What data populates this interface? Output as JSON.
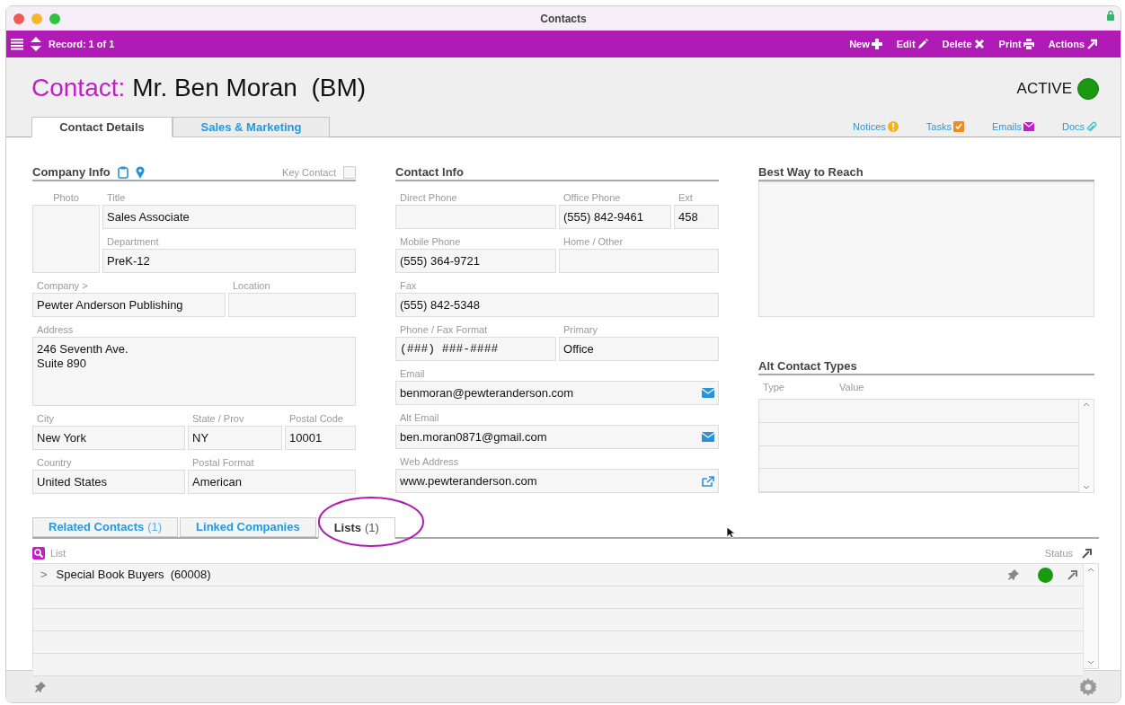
{
  "window": {
    "title": "Contacts"
  },
  "toolbar": {
    "record": "Record: 1 of 1",
    "actions": [
      {
        "label": "New"
      },
      {
        "label": "Edit"
      },
      {
        "label": "Delete"
      },
      {
        "label": "Print"
      },
      {
        "label": "Actions"
      }
    ]
  },
  "header": {
    "prefix": "Contact:",
    "name": "Mr. Ben Moran  (BM)",
    "status": "ACTIVE"
  },
  "tabs": [
    {
      "label": "Contact Details",
      "selected": true
    },
    {
      "label": "Sales & Marketing",
      "selected": false
    }
  ],
  "quick_links": [
    {
      "label": "Notices"
    },
    {
      "label": "Tasks"
    },
    {
      "label": "Emails"
    },
    {
      "label": "Docs"
    }
  ],
  "company_info": {
    "title": "Company Info",
    "key_contact": {
      "label": "Key Contact",
      "checked": false
    },
    "photo_label": "Photo",
    "side_rows": [
      [
        {
          "label": "Title",
          "value": "Sales Associate",
          "kind": "text"
        }
      ],
      [
        {
          "label": "Department",
          "value": "PreK-12",
          "kind": "text"
        }
      ]
    ],
    "rows": [
      [
        {
          "label": "Company >",
          "value": "Pewter Anderson Publishing",
          "kind": "text"
        },
        {
          "label": "Location",
          "kind": "text"
        }
      ],
      [
        {
          "label": "Address",
          "value": "246 Seventh Ave.\nSuite 890",
          "kind": "multiline"
        }
      ],
      [
        {
          "label": "City",
          "value": "New York",
          "kind": "text"
        },
        {
          "label": "State / Prov",
          "value": "NY",
          "kind": "text"
        },
        {
          "label": "Postal Code",
          "value": "10001",
          "kind": "text"
        }
      ],
      [
        {
          "label": "Country",
          "value": "United States",
          "kind": "text"
        },
        {
          "label": "Postal Format",
          "value": "American",
          "kind": "text"
        }
      ]
    ]
  },
  "contact_info": {
    "title": "Contact Info",
    "rows": [
      [
        {
          "label": "Direct Phone",
          "kind": "text"
        },
        {
          "label": "Office Phone",
          "value": "(555) 842-9461",
          "kind": "text"
        },
        {
          "label": "Ext",
          "value": "458",
          "kind": "text"
        }
      ],
      [
        {
          "label": "Mobile Phone",
          "value": "(555) 364-9721",
          "kind": "text"
        },
        {
          "label": "Home / Other",
          "kind": "text"
        }
      ],
      [
        {
          "label": "Fax",
          "value": "(555) 842-5348",
          "kind": "text"
        }
      ],
      [
        {
          "label": "Phone / Fax Format",
          "value": "(###) ###-####",
          "kind": "format"
        },
        {
          "label": "Primary",
          "value": "Office",
          "kind": "text"
        }
      ],
      [
        {
          "label": "Email",
          "value": "benmoran@pewteranderson.com",
          "kind": "email"
        }
      ],
      [
        {
          "label": "Alt Email",
          "value": "ben.moran0871@gmail.com",
          "kind": "email"
        }
      ],
      [
        {
          "label": "Web Address",
          "value": "www.pewteranderson.com",
          "kind": "link"
        }
      ]
    ]
  },
  "best_way_to_reach": {
    "title": "Best Way to Reach"
  },
  "alt_contact_types": {
    "title": "Alt Contact Types",
    "columns": [
      "Type",
      "Value"
    ]
  },
  "bottom_tabs": [
    {
      "label": "Related Contacts",
      "count": "(1)",
      "selected": false
    },
    {
      "label": "Linked Companies",
      "selected": false
    },
    {
      "label": "Lists",
      "count": "(1)",
      "selected": true
    }
  ],
  "lists_table": {
    "columns": [
      "List",
      "Status"
    ],
    "rows": [
      {
        "expander": ">",
        "name": "Special Book Buyers  (60008)"
      }
    ]
  }
}
